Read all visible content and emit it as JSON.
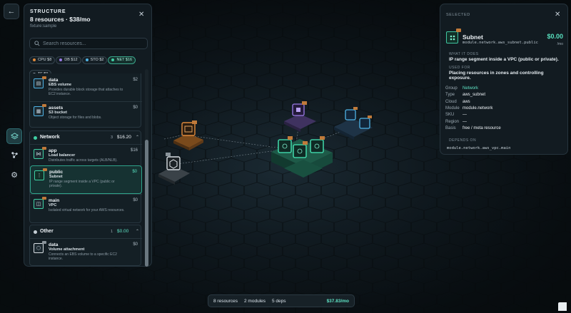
{
  "rail": {
    "back_icon": "arrow-left-icon",
    "items": [
      {
        "icon": "layers-icon",
        "active": true
      },
      {
        "icon": "graph-nodes-icon",
        "active": false
      },
      {
        "icon": "gear-icon",
        "active": false
      }
    ]
  },
  "structure": {
    "title": "STRUCTURE",
    "summary": "8 resources · $38/mo",
    "fixture": "fixture:sample",
    "search_placeholder": "Search resources...",
    "chips": [
      {
        "label": "CPU $8",
        "color": "#e08a3c",
        "active": false
      },
      {
        "label": "DB $12",
        "color": "#9b7be8",
        "active": false
      },
      {
        "label": "STO $2",
        "color": "#4fb4e6",
        "active": false
      },
      {
        "label": "NET $16",
        "color": "#3fd0a4",
        "active": true
      },
      {
        "label": "TF $0",
        "color": "#8a96a0",
        "active": false
      }
    ],
    "storage_items": [
      {
        "name": "data",
        "type": "EBS volume",
        "desc": "Provides durable block storage that attaches to EC2 instance.",
        "price": "$2"
      },
      {
        "name": "assets",
        "type": "S3 bucket",
        "desc": "Object storage for files and blobs.",
        "price": "$0"
      }
    ],
    "network_group": {
      "name": "Network",
      "count": "3",
      "cost": "$16.20",
      "color": "#3fd0a4"
    },
    "network_items": [
      {
        "name": "app",
        "type": "Load balancer",
        "desc": "Distributes traffic across targets (ALB/NLB).",
        "price": "$16"
      },
      {
        "name": "public",
        "type": "Subnet",
        "desc": "IP range segment inside a VPC (public or private).",
        "price": "$0"
      },
      {
        "name": "main",
        "type": "VPC",
        "desc": "Isolated virtual network for your AWS resources.",
        "price": "$0"
      }
    ],
    "other_group": {
      "name": "Other",
      "count": "1",
      "cost": "$0.00",
      "color": "#c5ced5"
    },
    "other_items": [
      {
        "name": "data",
        "type": "Volume attachment",
        "desc": "Connects an EBS volume to a specific EC2 instance.",
        "price": "$0"
      }
    ]
  },
  "selected": {
    "heading": "SELECTED",
    "name": "Subnet",
    "path": "module.network.aws_subnet.public",
    "price": "$0.00",
    "unit": "/mo",
    "what_label": "WHAT IT DOES",
    "what_text": "IP range segment inside a VPC (public or private).",
    "used_label": "USED FOR",
    "used_text": "Placing resources in zones and controlling exposure.",
    "fields": [
      {
        "k": "Group",
        "v": "Network"
      },
      {
        "k": "Type",
        "v": "aws_subnet"
      },
      {
        "k": "Cloud",
        "v": "aws"
      },
      {
        "k": "Module",
        "v": "module.network"
      },
      {
        "k": "SKU",
        "v": "—"
      },
      {
        "k": "Region",
        "v": "—"
      },
      {
        "k": "Basis",
        "v": "free / meta resource"
      }
    ],
    "depends_label": "DEPENDS ON",
    "depends": "module.network.aws_vpc.main"
  },
  "status": {
    "resources": "8 resources",
    "modules": "2 modules",
    "deps": "5 deps",
    "cost": "$37.83/mo"
  },
  "colors": {
    "accent": "#3fd0a4",
    "compute": "#e08a3c",
    "database": "#9b7be8",
    "storage": "#4fb4e6"
  }
}
